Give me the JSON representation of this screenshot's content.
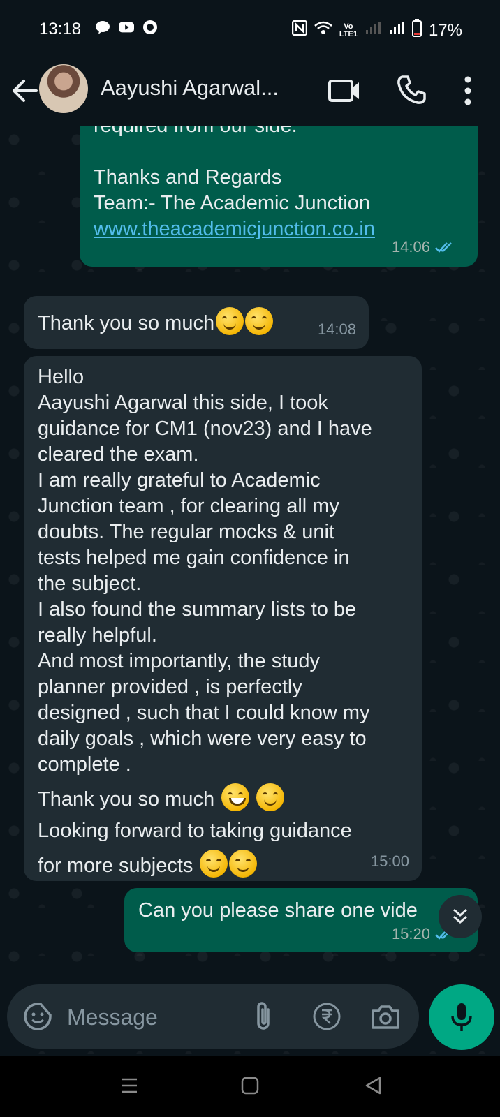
{
  "status_bar": {
    "time": "13:18",
    "network_top": "Vo",
    "network_bottom": "LTE1",
    "battery": "17%"
  },
  "header": {
    "contact_name": "Aayushi Agarwal..."
  },
  "messages": [
    {
      "direction": "outgoing",
      "lines": [
        "required from our side.",
        "",
        "Thanks and Regards",
        "Team:- The Academic Junction"
      ],
      "link": "www.theacademicjunction.co.in",
      "time": "14:06",
      "read": true
    },
    {
      "direction": "incoming",
      "lines": [
        "Thank you so much"
      ],
      "time": "14:08"
    },
    {
      "direction": "incoming",
      "lines": [
        "Hello",
        "Aayushi Agarwal this side, I took",
        "guidance for CM1 (nov23) and I have",
        "cleared the exam.",
        "I am really grateful to Academic",
        "Junction team , for clearing all my",
        "doubts. The regular mocks & unit",
        "tests helped me gain confidence in",
        "the subject.",
        "I also found the summary lists to be",
        "really helpful.",
        "And most importantly, the study",
        "planner provided , is perfectly",
        "designed , such that I could know my",
        "daily goals , which were very easy to",
        "complete .",
        "Thank you so much",
        "Looking forward to taking guidance",
        "for more subjects"
      ],
      "time": "15:00"
    },
    {
      "direction": "outgoing",
      "lines": [
        "Can you please share one vide"
      ],
      "time": "15:20",
      "read": true
    }
  ],
  "composer": {
    "placeholder": "Message"
  },
  "colors": {
    "background": "#0b141a",
    "outgoing_bubble": "#005c4b",
    "incoming_bubble": "#202c33",
    "accent": "#00a884",
    "read_ticks": "#53bdeb"
  }
}
